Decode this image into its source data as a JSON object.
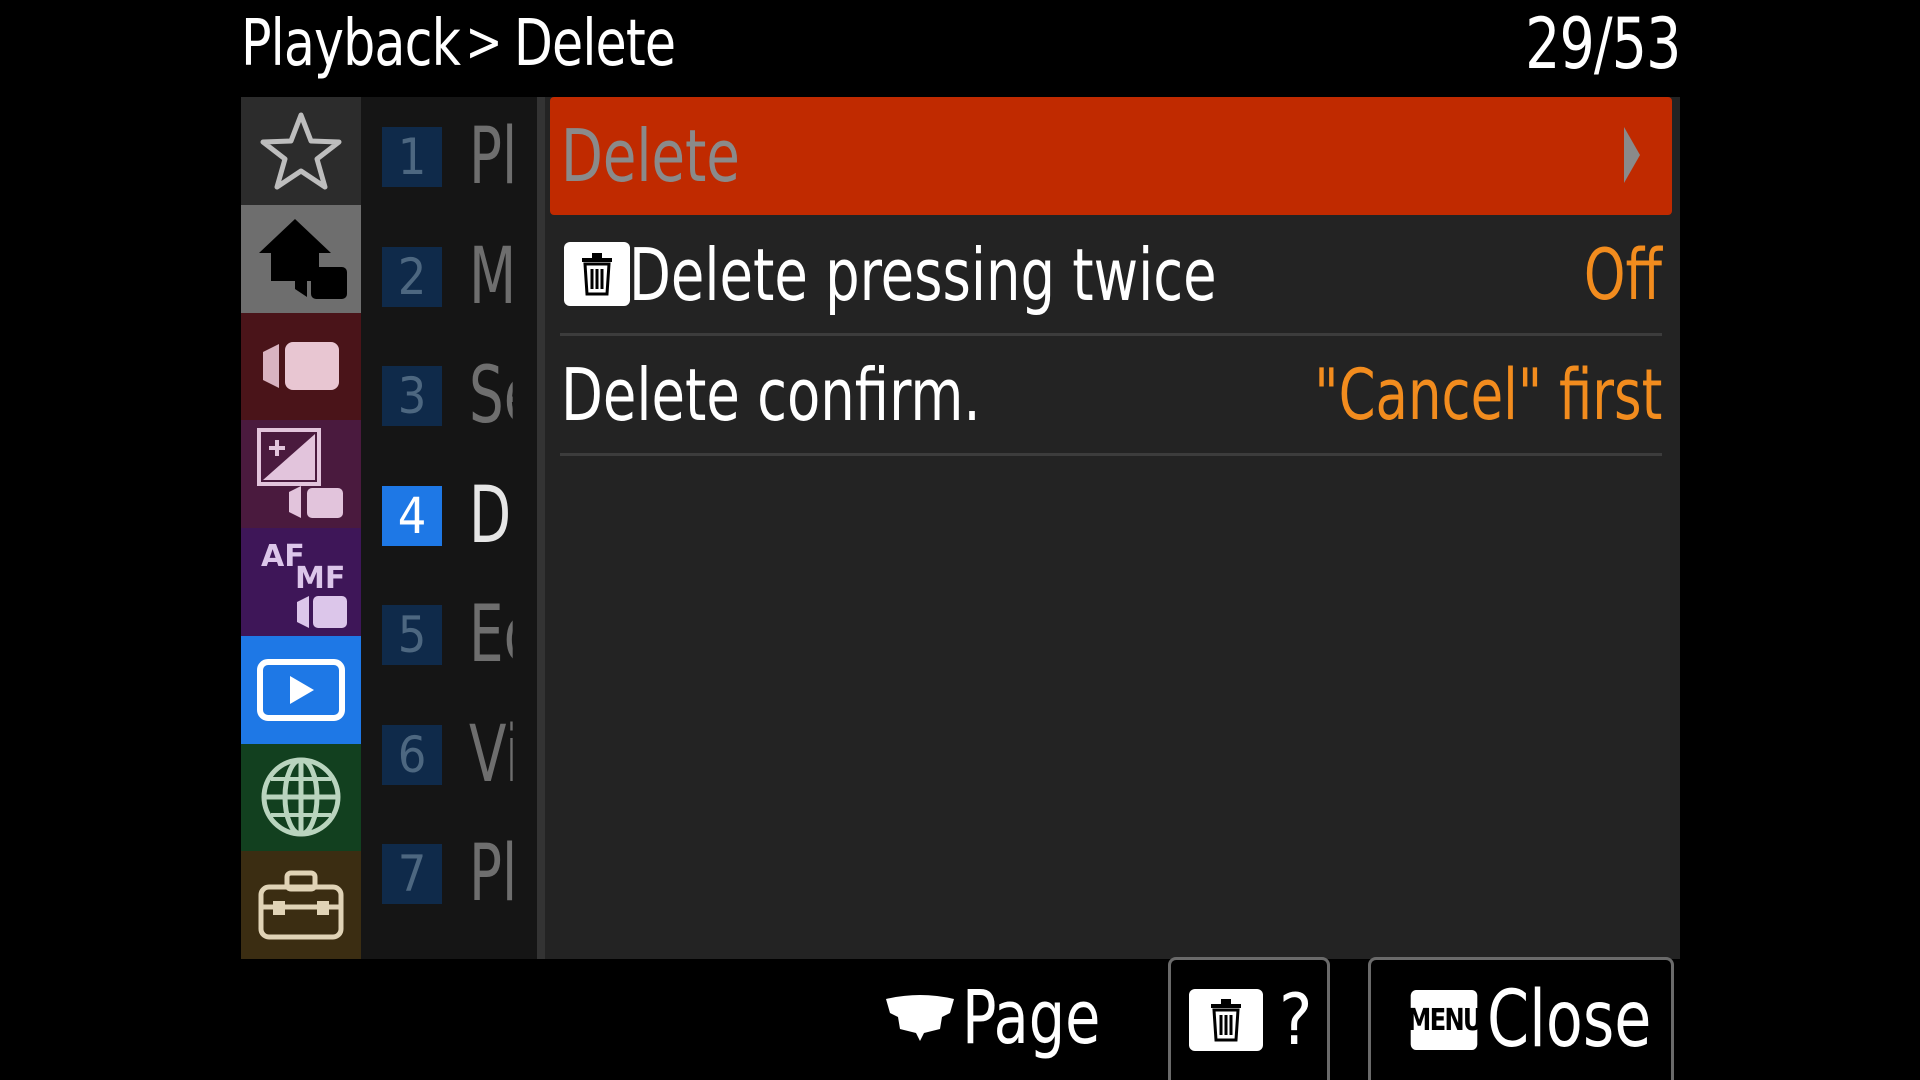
{
  "header": {
    "section": "Playback",
    "separator": ">",
    "subsection": "Delete",
    "page_counter": "29/53"
  },
  "categories": [
    {
      "icon": "star-icon",
      "name": "favorites"
    },
    {
      "icon": "home-camera-icon",
      "name": "main"
    },
    {
      "icon": "movie-icon",
      "name": "shooting"
    },
    {
      "icon": "exposure-icon",
      "name": "exposure-color"
    },
    {
      "icon": "af-mf-icon",
      "name": "focus"
    },
    {
      "icon": "playback-icon",
      "name": "playback",
      "active": true
    },
    {
      "icon": "globe-icon",
      "name": "network"
    },
    {
      "icon": "toolbox-icon",
      "name": "setup"
    }
  ],
  "pages": [
    {
      "num": "1",
      "label": "Pl"
    },
    {
      "num": "2",
      "label": "M"
    },
    {
      "num": "3",
      "label": "Se"
    },
    {
      "num": "4",
      "label": "De",
      "active": true
    },
    {
      "num": "5",
      "label": "Ec"
    },
    {
      "num": "6",
      "label": "Vi"
    },
    {
      "num": "7",
      "label": "Pl"
    }
  ],
  "items": [
    {
      "label": "Delete",
      "value": "",
      "selected": true
    },
    {
      "label": "Delete pressing twice",
      "value": "Off",
      "icon": "trash-icon"
    },
    {
      "label": "Delete confirm.",
      "value": "\"Cancel\" first"
    }
  ],
  "af_text": {
    "af": "AF",
    "mf": "MF"
  },
  "footer": {
    "page_label": "Page",
    "help_label": "?",
    "menu_badge": "MENU",
    "close_label": "Close"
  },
  "colors": {
    "selected": "#c02a00",
    "value": "#f28c1e",
    "active_tab": "#1e78e6"
  }
}
